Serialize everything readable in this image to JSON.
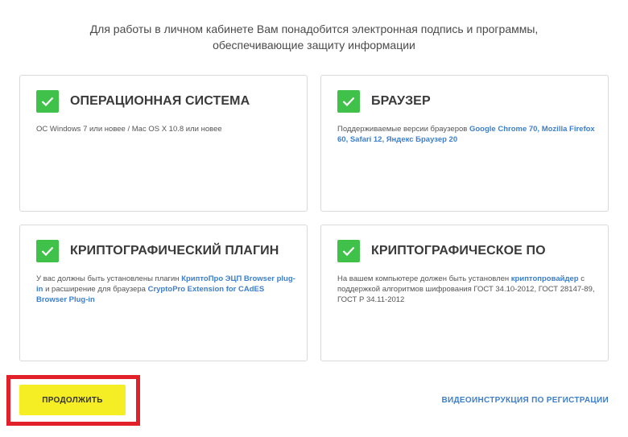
{
  "intro": {
    "line1": "Для работы в личном кабинете Вам понадобится электронная подпись и программы,",
    "line2": "обеспечивающие защиту информации"
  },
  "cards": [
    {
      "title": "ОПЕРАЦИОННАЯ СИСТЕМА",
      "text": "ОС Windows 7 или новее / Mac OS X 10.8 или новее"
    },
    {
      "title": "БРАУЗЕР",
      "text_prefix": "Поддерживаемые версии браузеров ",
      "links": "Google Chrome 70, Mozilla Firefox 60, Safari 12, Яндекс Браузер 20"
    },
    {
      "title": "КРИПТОГРАФИЧЕСКИЙ ПЛАГИН",
      "text_prefix": "У вас должны быть установлены плагин ",
      "link1": "КриптоПро ЭЦП Browser plug-in",
      "text_mid": " и расширение для браузера ",
      "link2": "CryptoPro Extension for CAdES Browser Plug-in"
    },
    {
      "title": "КРИПТОГРАФИЧЕСКОЕ ПО",
      "text_prefix": "На вашем компьютере должен быть установлен ",
      "link": "криптопровайдер",
      "text_suffix": " с поддержкой алгоритмов шифрования ГОСТ 34.10-2012, ГОСТ 28147-89, ГОСТ Р 34.11-2012"
    }
  ],
  "actions": {
    "continue_label": "ПРОДОЛЖИТЬ",
    "video_label": "ВИДЕОИНСТРУКЦИЯ ПО РЕГИСТРАЦИИ"
  },
  "colors": {
    "check": "#3fc14a",
    "link": "#3d7fcc",
    "button": "#f5ee24",
    "highlight": "#e2202a"
  }
}
